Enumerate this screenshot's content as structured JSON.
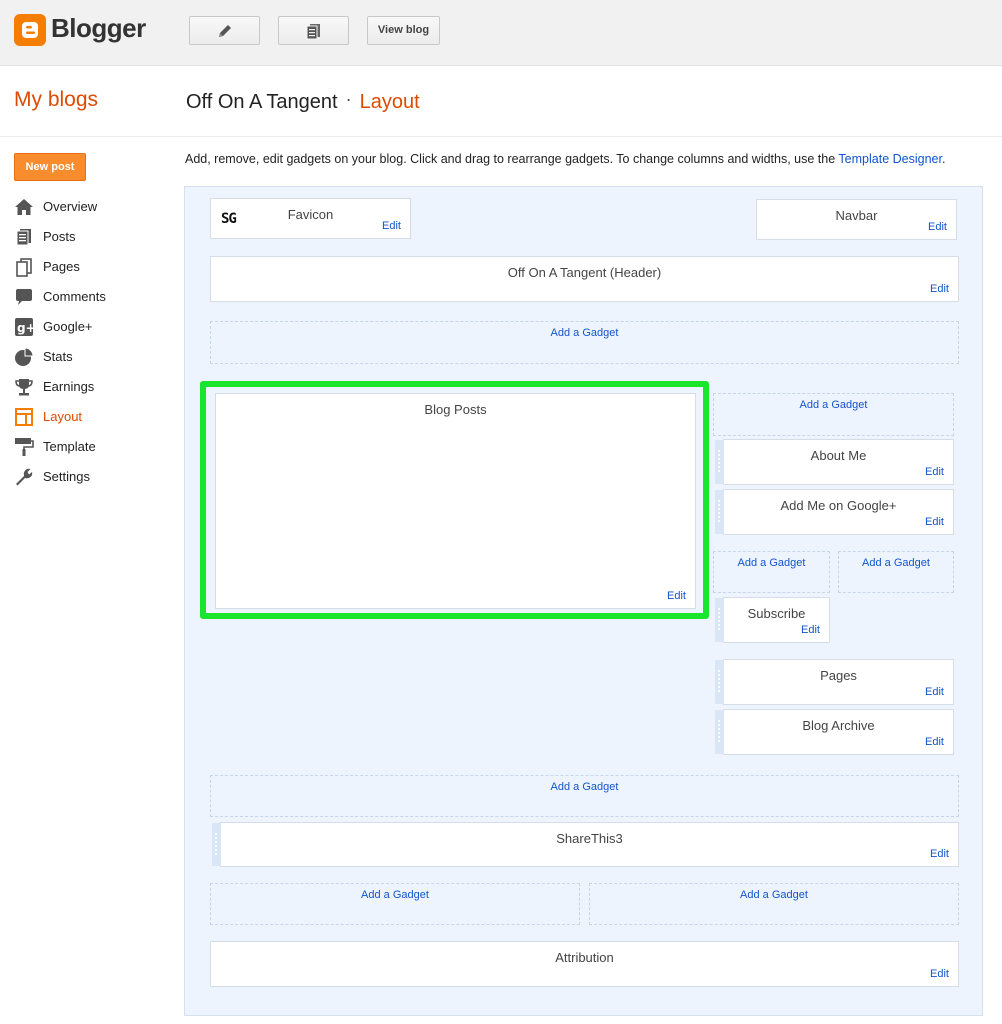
{
  "app": {
    "name": "Blogger",
    "brand_color": "#f57d00",
    "accent_color": "#dd4b00",
    "link_color": "#1155cc",
    "highlight_color": "#19e62a"
  },
  "toolbar": {
    "edit_icon": "pencil-icon",
    "posts_icon": "document-list-icon",
    "view_blog_label": "View blog"
  },
  "header": {
    "my_blogs": "My blogs",
    "blog_title": "Off On A Tangent",
    "separator": "·",
    "section": "Layout"
  },
  "sidebar": {
    "new_post_label": "New post",
    "items": [
      {
        "label": "Overview",
        "icon": "home-icon"
      },
      {
        "label": "Posts",
        "icon": "posts-icon"
      },
      {
        "label": "Pages",
        "icon": "pages-icon"
      },
      {
        "label": "Comments",
        "icon": "comment-icon"
      },
      {
        "label": "Google+",
        "icon": "google-plus-icon"
      },
      {
        "label": "Stats",
        "icon": "pie-chart-icon"
      },
      {
        "label": "Earnings",
        "icon": "trophy-icon"
      },
      {
        "label": "Layout",
        "icon": "layout-icon",
        "active": true
      },
      {
        "label": "Template",
        "icon": "paint-roller-icon"
      },
      {
        "label": "Settings",
        "icon": "wrench-icon"
      }
    ]
  },
  "description": {
    "text": "Add, remove, edit gadgets on your blog. Click and drag to rearrange gadgets. To change columns and widths, use the ",
    "link": "Template Designer",
    "end": "."
  },
  "layout": {
    "edit_label": "Edit",
    "add_gadget_label": "Add a Gadget",
    "favicon": {
      "title": "Favicon",
      "logo": "SG"
    },
    "navbar": {
      "title": "Navbar"
    },
    "header_gadget": {
      "title": "Off On A Tangent (Header)"
    },
    "blog_posts": {
      "title": "Blog Posts"
    },
    "about_me": {
      "title": "About Me"
    },
    "google_plus": {
      "title": "Add Me on Google+"
    },
    "subscribe": {
      "title": "Subscribe"
    },
    "pages": {
      "title": "Pages"
    },
    "blog_archive": {
      "title": "Blog Archive"
    },
    "sharethis": {
      "title": "ShareThis3"
    },
    "attribution": {
      "title": "Attribution"
    }
  }
}
